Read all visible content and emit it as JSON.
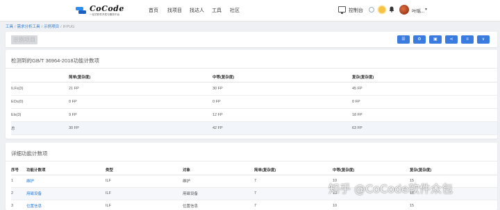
{
  "nav": {
    "logo_text": "CoCode",
    "logo_sub": "一站式软件开发与服务平台",
    "items": [
      "首页",
      "找项目",
      "找达人",
      "工具",
      "社区"
    ],
    "console_label": "控制台",
    "user_name": "叶瑶..."
  },
  "breadcrumb": [
    "工具",
    "需求分析工具",
    "示例项目",
    "IFPUG"
  ],
  "page_title": "示例项目",
  "toolbar": {
    "buttons": [
      "list-icon",
      "gear-icon",
      "window-icon",
      "share-icon",
      "sliders-icon",
      "chevron-down-icon"
    ],
    "glyphs": [
      "☰",
      "⚙",
      "▣",
      "⋖",
      "≡",
      "∨"
    ]
  },
  "summary": {
    "title": "检测到的GB/T 36964-2018功能计数项",
    "headers": [
      "",
      "简单(复杂度)",
      "中等(复杂度)",
      "复杂(复杂度)"
    ],
    "rows": [
      [
        "ILFs(3)",
        "21 FP",
        "30 FP",
        "45 FP"
      ],
      [
        "EOs(0)",
        "0 FP",
        "0 FP",
        "0 FP"
      ],
      [
        "Els(3)",
        "9 FP",
        "12 FP",
        "18 FP"
      ],
      [
        "总",
        "30 FP",
        "42 FP",
        "63 FP"
      ]
    ]
  },
  "detail": {
    "title": "详细功能计数项",
    "headers": [
      "序号",
      "功能计数项",
      "类型",
      "对象",
      "简单(复杂度)",
      "中等(复杂度)",
      "复杂(复杂度)"
    ],
    "rows": [
      [
        "1",
        "维护",
        "ILF",
        "维护",
        "7",
        "10",
        "15"
      ],
      [
        "2",
        "用磁设备",
        "ILF",
        "用磁设备",
        "7",
        "10",
        "15"
      ],
      [
        "3",
        "位置信息",
        "ILF",
        "位置信息",
        "7",
        "10",
        "15"
      ]
    ]
  },
  "watermark": "知乎 @CoCode软件众包",
  "colors": {
    "primary": "#3a7be0",
    "link": "#2b7bd6",
    "background": "#eef0f3"
  }
}
